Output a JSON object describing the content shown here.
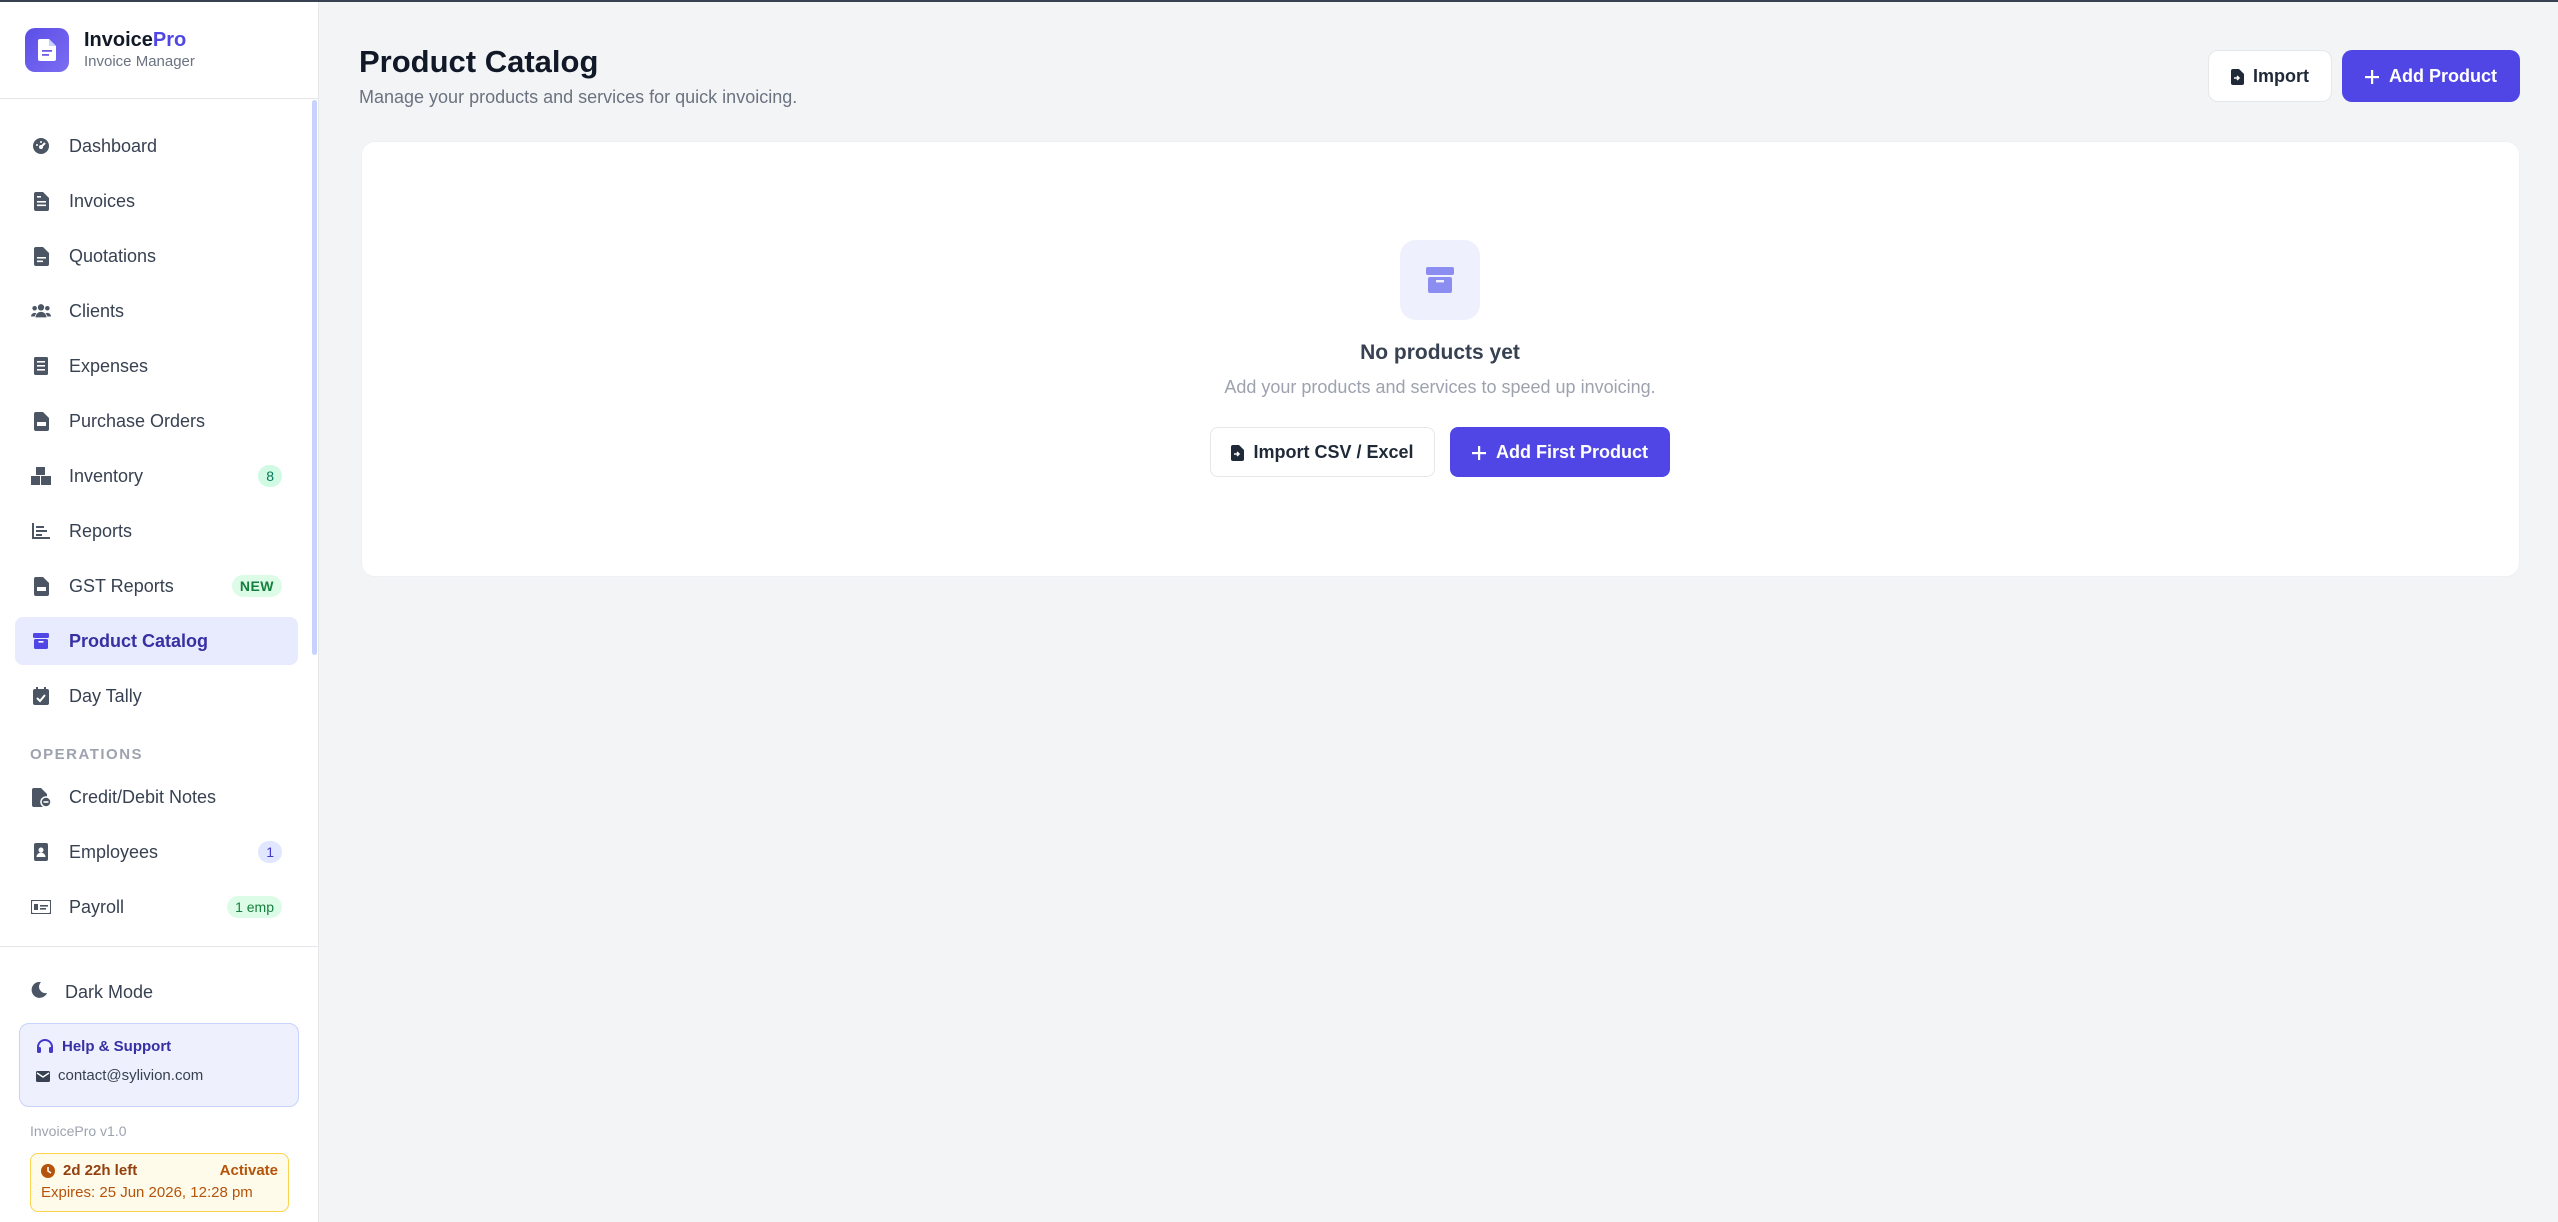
{
  "brand": {
    "name_main": "Invoice",
    "name_accent": "Pro",
    "subtitle": "Invoice Manager"
  },
  "sidebar": {
    "items": [
      {
        "label": "Dashboard",
        "icon": "dashboard-icon"
      },
      {
        "label": "Invoices",
        "icon": "invoice-icon"
      },
      {
        "label": "Quotations",
        "icon": "quotation-icon"
      },
      {
        "label": "Clients",
        "icon": "users-icon"
      },
      {
        "label": "Expenses",
        "icon": "receipt-icon"
      },
      {
        "label": "Purchase Orders",
        "icon": "file-invoice-icon"
      },
      {
        "label": "Inventory",
        "icon": "boxes-icon",
        "badge": "8"
      },
      {
        "label": "Reports",
        "icon": "bar-chart-icon"
      },
      {
        "label": "GST Reports",
        "icon": "file-invoice-icon",
        "badge": "NEW"
      },
      {
        "label": "Product Catalog",
        "icon": "box-icon",
        "active": true
      },
      {
        "label": "Day Tally",
        "icon": "calendar-check-icon"
      }
    ],
    "section_label": "OPERATIONS",
    "operations": [
      {
        "label": "Credit/Debit Notes",
        "icon": "file-note-icon"
      },
      {
        "label": "Employees",
        "icon": "id-badge-icon",
        "badge": "1"
      },
      {
        "label": "Payroll",
        "icon": "money-bill-icon",
        "badge": "1 emp"
      }
    ],
    "dark_mode_label": "Dark Mode",
    "help": {
      "title": "Help & Support",
      "email": "contact@sylivion.com"
    },
    "version": "InvoicePro v1.0",
    "trial": {
      "time_left": "2d 22h left",
      "activate": "Activate",
      "expires": "Expires: 25 Jun 2026, 12:28 pm"
    }
  },
  "header": {
    "title": "Product Catalog",
    "subtitle": "Manage your products and services for quick invoicing.",
    "import_label": "Import",
    "add_label": "Add Product"
  },
  "empty_state": {
    "title": "No products yet",
    "subtitle": "Add your products and services to speed up invoicing.",
    "import_label": "Import CSV / Excel",
    "add_label": "Add First Product"
  },
  "colors": {
    "accent": "#4f46e5",
    "active_bg": "#e8eafd",
    "page_bg": "#f3f4f6"
  }
}
